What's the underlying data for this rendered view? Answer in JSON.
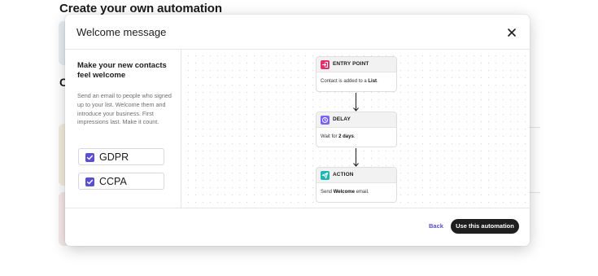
{
  "background": {
    "page_title": "Create your own automation",
    "partial_heading": "C"
  },
  "modal": {
    "title": "Welcome message",
    "close_icon": "close-icon"
  },
  "left_pane": {
    "heading": "Make your new contacts feel welcome",
    "description": "Send an email to people who signed up to your list. Welcome them and introduce your business. First impressions last. Make it count.",
    "consents": [
      {
        "label": "GDPR",
        "checked": true
      },
      {
        "label": "CCPA",
        "checked": true
      }
    ]
  },
  "workflow": {
    "steps": [
      {
        "title": "ENTRY POINT",
        "icon": "entry-point-icon",
        "icon_color": "#e1306c",
        "body_prefix": "Contact is added to a ",
        "body_bold": "List",
        "body_suffix": "."
      },
      {
        "title": "DELAY",
        "icon": "clock-icon",
        "icon_color": "#7b61ff",
        "body_prefix": "Wait for ",
        "body_bold": "2 days",
        "body_suffix": "."
      },
      {
        "title": "ACTION",
        "icon": "send-icon",
        "icon_color": "#1fb5b5",
        "body_prefix": "Send ",
        "body_bold": "Welcome",
        "body_suffix": " email."
      }
    ]
  },
  "footer": {
    "back_label": "Back",
    "primary_label": "Use this automation"
  },
  "colors": {
    "accent": "#5a4fcf",
    "primary_button": "#1f1f1f"
  }
}
